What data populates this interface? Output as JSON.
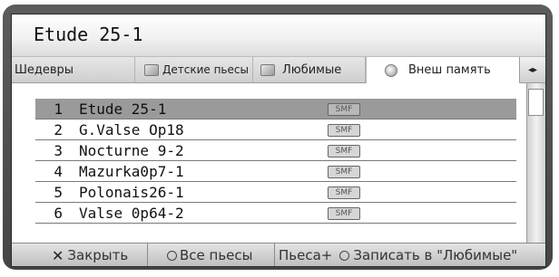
{
  "title": "Etude 25-1",
  "tabs": [
    {
      "label": "Шедевры",
      "icon": "none"
    },
    {
      "label": "Детские пьесы",
      "icon": "book-icon"
    },
    {
      "label": "Любимые",
      "icon": "book-icon"
    },
    {
      "label": "Внеш память",
      "icon": "memory-card-icon",
      "active": true
    }
  ],
  "tab_nav": "◂▸",
  "rows": [
    {
      "num": "1",
      "name": "Etude 25-1",
      "badge": "SMF",
      "selected": true
    },
    {
      "num": "2",
      "name": "G.Valse Op18",
      "badge": "SMF"
    },
    {
      "num": "3",
      "name": "Nocturne 9-2",
      "badge": "SMF"
    },
    {
      "num": "4",
      "name": "Mazurka0p7-1",
      "badge": "SMF"
    },
    {
      "num": "5",
      "name": "Polonais26-1",
      "badge": "SMF"
    },
    {
      "num": "6",
      "name": "Valse 0p64-2",
      "badge": "SMF"
    }
  ],
  "footer": {
    "close_icon": "✕",
    "close_label": "Закрыть",
    "all_pieces_label": "Все пьесы",
    "piece_plus_label": "Пьеса+",
    "save_favorites_label": "Записать в \"Любимые\""
  }
}
